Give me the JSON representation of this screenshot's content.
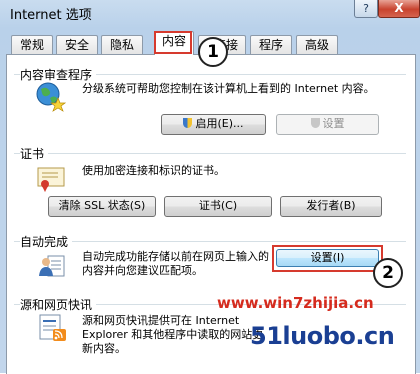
{
  "window": {
    "title": "Internet 选项",
    "help_label": "?",
    "close_label": "X"
  },
  "tabs": [
    {
      "label": "常规"
    },
    {
      "label": "安全"
    },
    {
      "label": "隐私"
    },
    {
      "label": "内容"
    },
    {
      "label": "连接"
    },
    {
      "label": "程序"
    },
    {
      "label": "高级"
    }
  ],
  "active_tab": "内容",
  "sections": {
    "content_advisor": {
      "title": "内容审查程序",
      "description": "分级系统可帮助您控制在该计算机上看到的 Internet 内容。",
      "enable_button": "启用(E)...",
      "settings_button": "设置"
    },
    "certificates": {
      "title": "证书",
      "description": "使用加密连接和标识的证书。",
      "clear_ssl_button": "清除 SSL 状态(S)",
      "certificates_button": "证书(C)",
      "publishers_button": "发行者(B)"
    },
    "autocomplete": {
      "title": "自动完成",
      "description": "自动完成功能存储以前在网页上输入的内容并向您建议匹配项。",
      "settings_button": "设置(I)"
    },
    "feeds": {
      "title": "源和网页快讯",
      "description": "源和网页快讯提供可在 Internet Explorer 和其他程序中读取的网站更新内容。"
    }
  },
  "annotations": {
    "callout_1": "1",
    "callout_2": "2"
  },
  "watermarks": {
    "top": "www.win7zhijia.cn",
    "bottom": "51luobo.cn"
  },
  "colors": {
    "highlight_red": "#d63a2e",
    "title_bar": "#b9d1ea"
  }
}
